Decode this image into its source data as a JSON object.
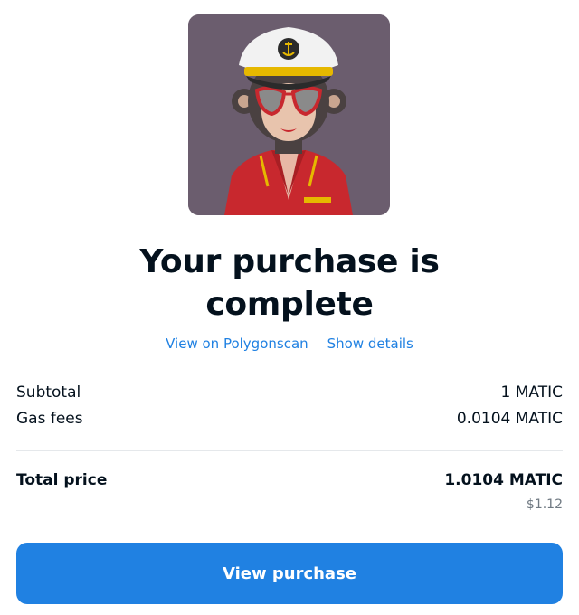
{
  "nft": {
    "background_color": "#6b5d6e",
    "icon": "captain-monkey-nft-image"
  },
  "title": {
    "line1": "Your purchase is",
    "line2": "complete"
  },
  "links": {
    "explorer": "View on Polygonscan",
    "details": "Show details"
  },
  "summary": {
    "subtotal_label": "Subtotal",
    "subtotal_value": "1 MATIC",
    "gas_label": "Gas fees",
    "gas_value": "0.0104 MATIC",
    "total_label": "Total price",
    "total_value": "1.0104 MATIC",
    "total_usd": "$1.12"
  },
  "button": {
    "label": "View purchase"
  },
  "colors": {
    "accent": "#2081e2",
    "text": "#04111d",
    "muted": "#707a83"
  }
}
